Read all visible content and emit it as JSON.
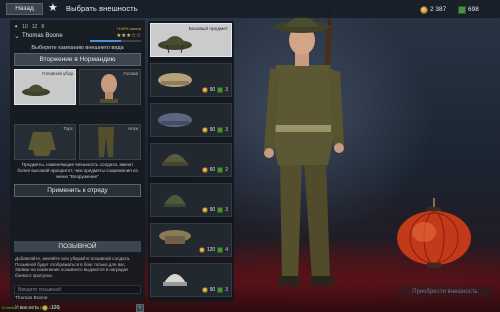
{
  "topbar": {
    "back_label": "Назад",
    "title": "Выбрать внешность",
    "coins": "2 387",
    "tickets": "698"
  },
  "player": {
    "stats": [
      "10",
      "12",
      "8"
    ],
    "name": "Thomas Boone",
    "xp_bonus": "+100% опыта",
    "rank_stars": "★★★☆☆",
    "xp_progress": 0.6
  },
  "campaign": {
    "prompt": "Выберите кампанию внешнего вида",
    "selected": "Вторжение в Нормандию"
  },
  "slots": [
    {
      "label": "Головной убор",
      "icon": "helmet-icon"
    },
    {
      "label": "Голова",
      "icon": "head-icon"
    },
    {
      "label": "Торс",
      "icon": "torso-icon"
    },
    {
      "label": "Ноги",
      "icon": "legs-icon"
    }
  ],
  "notice": "Предметы, изменяющие внешность солдата, имеют более высокий приоритет, чем предметы снаряжения из меню \"Вооружение\"",
  "apply_label": "Применить к отряду",
  "callsign": {
    "header": "ПОЗЫВНОЙ",
    "description": "Добавляйте, меняйте или убирайте позывной солдата. Позывной будет отображаться в бою только для вас. Заявки на изменение позывного выдаются в наградах боевого пропуска.",
    "placeholder": "Введите позывной",
    "preview_name": "Thomas Boone",
    "balance_label": "У вас есть",
    "balance_value": "120"
  },
  "items": [
    {
      "type": "helmet",
      "base_label": "Базовый предмет",
      "selected": true
    },
    {
      "type": "beret-khaki",
      "price": "90",
      "stock": "3"
    },
    {
      "type": "beret-blue",
      "price": "90",
      "stock": "3"
    },
    {
      "type": "helmet-mk",
      "price": "60",
      "stock": "2"
    },
    {
      "type": "helmet-green",
      "price": "90",
      "stock": "3"
    },
    {
      "type": "officer-cap",
      "price": "120",
      "stock": "4"
    },
    {
      "type": "helmet-white",
      "price": "90",
      "stock": "3"
    }
  ],
  "purchase_label": "Приобрести внешность",
  "version": "Enlisted 1.0.99.4b (4.5.17.0-9e7)",
  "colors": {
    "panel": "#16191f",
    "selected_slot": "#c7c9cb",
    "coin": "#e2b14b",
    "stock": "#4f8f3c",
    "version_text": "#1fd34a"
  }
}
